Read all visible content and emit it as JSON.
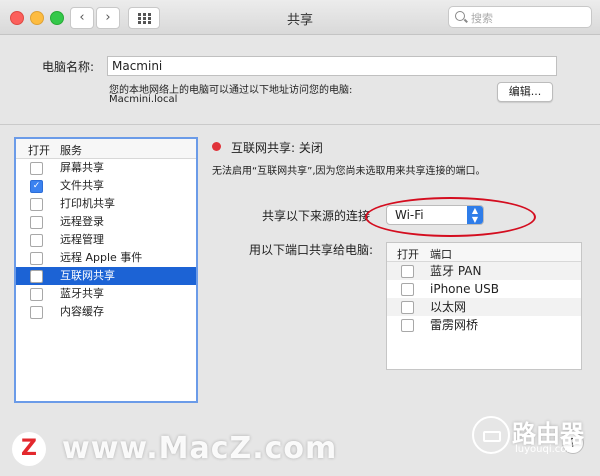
{
  "window": {
    "title": "共享"
  },
  "search": {
    "placeholder": "搜索"
  },
  "computer": {
    "label": "电脑名称:",
    "name": "Macmini",
    "info": "您的本地网络上的电脑可以通过以下地址访问您的电脑:",
    "address": "Macmini.local",
    "edit_button": "编辑..."
  },
  "services": {
    "headers": {
      "on": "打开",
      "name": "服务"
    },
    "items": [
      {
        "label": "屏幕共享",
        "checked": false,
        "selected": false
      },
      {
        "label": "文件共享",
        "checked": true,
        "selected": false
      },
      {
        "label": "打印机共享",
        "checked": false,
        "selected": false
      },
      {
        "label": "远程登录",
        "checked": false,
        "selected": false
      },
      {
        "label": "远程管理",
        "checked": false,
        "selected": false
      },
      {
        "label": "远程 Apple 事件",
        "checked": false,
        "selected": false
      },
      {
        "label": "互联网共享",
        "checked": false,
        "selected": true
      },
      {
        "label": "蓝牙共享",
        "checked": false,
        "selected": false
      },
      {
        "label": "内容缓存",
        "checked": false,
        "selected": false
      }
    ]
  },
  "detail": {
    "status": "互联网共享: 关闭",
    "status_color": "#e0333a",
    "note": "无法启用“互联网共享”,因为您尚未选取用来共享连接的端口。",
    "source_label": "共享以下来源的连接",
    "source_value": "Wi-Fi",
    "ports_label": "用以下端口共享给电脑:",
    "ports_headers": {
      "on": "打开",
      "name": "端口"
    },
    "ports": [
      {
        "label": "蓝牙 PAN",
        "checked": false
      },
      {
        "label": "iPhone USB",
        "checked": false
      },
      {
        "label": "以太网",
        "checked": false
      },
      {
        "label": "雷雳网桥",
        "checked": false
      }
    ]
  },
  "help": "?",
  "watermark": {
    "site": "www.MacZ.com",
    "logo": "Z",
    "brand": "路由器",
    "brand_url": "luyouqi.com"
  },
  "colors": {
    "selection": "#1c63d5",
    "accent": "#2f7de9",
    "highlight_ring": "#d40d1f"
  }
}
